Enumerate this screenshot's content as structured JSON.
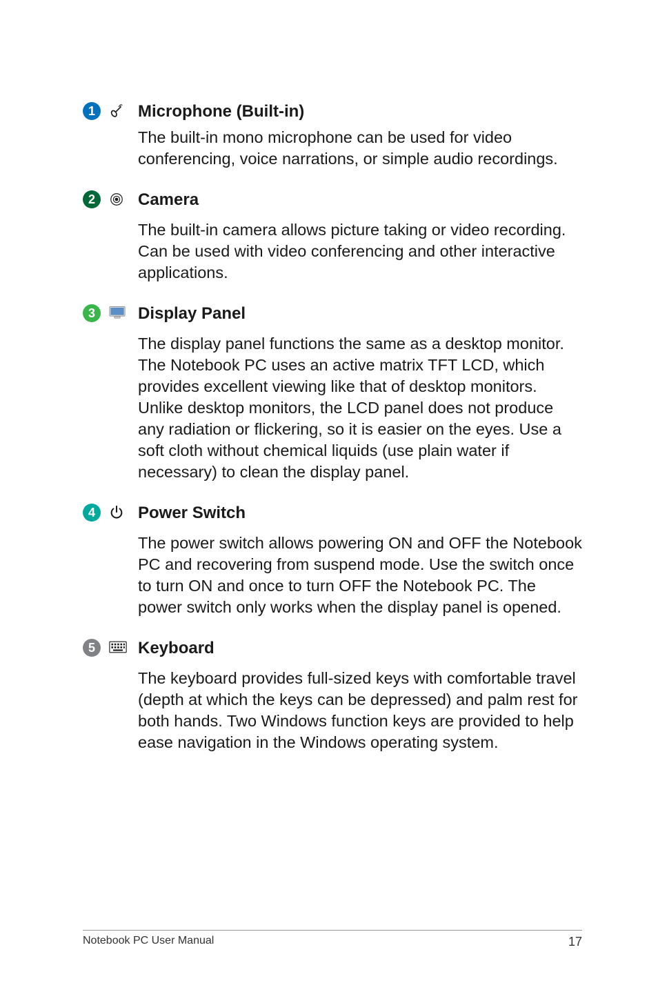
{
  "items": [
    {
      "num": "1",
      "num_color": "c-blue",
      "title": "Microphone (Built-in)",
      "desc": "The built-in mono microphone can be used for video conferencing, voice narrations, or simple audio recordings."
    },
    {
      "num": "2",
      "num_color": "c-green-dark",
      "title": "Camera",
      "desc": "The built-in camera allows picture taking or video recording. Can be used with video conferencing and other interactive applications."
    },
    {
      "num": "3",
      "num_color": "c-green",
      "title": "Display Panel",
      "desc": "The display panel functions the same as a desktop monitor. The Notebook PC uses an active matrix TFT LCD, which provides excellent viewing like that of desktop monitors. Unlike desktop monitors, the LCD panel does not produce any radiation or flickering, so it is easier on the eyes. Use a soft cloth without chemical liquids (use plain water if necessary) to clean the display panel."
    },
    {
      "num": "4",
      "num_color": "c-teal",
      "title": "Power Switch",
      "desc": "The power switch allows powering ON and OFF the Notebook PC and recovering from suspend mode. Use the switch once to turn ON and once to turn OFF the Notebook PC. The power switch only works when the display panel is opened."
    },
    {
      "num": "5",
      "num_color": "c-grey",
      "title": "Keyboard",
      "desc": "The keyboard provides full-sized keys with comfortable travel (depth at which the keys can be depressed) and palm rest for both hands. Two Windows function keys are provided to help ease navigation in the Windows operating system."
    }
  ],
  "footer": {
    "title": "Notebook PC User Manual",
    "page": "17"
  }
}
